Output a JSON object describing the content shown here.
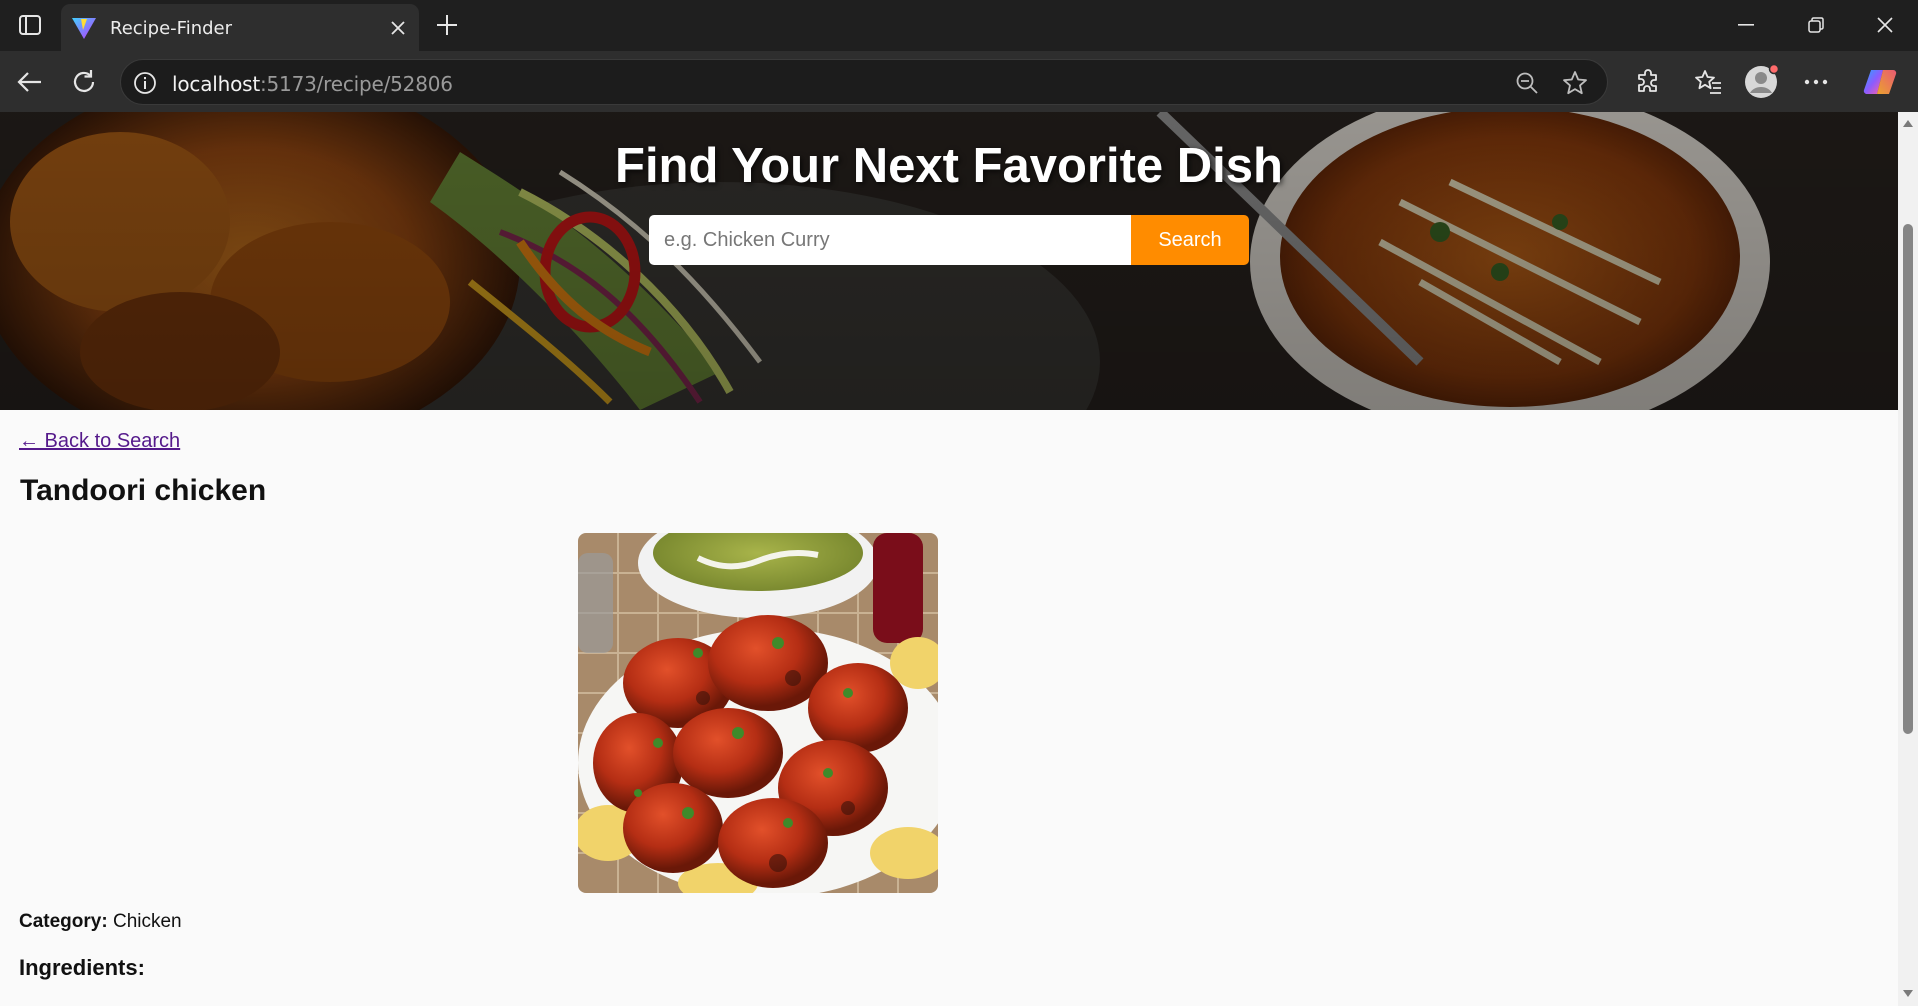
{
  "browser": {
    "tab_title": "Recipe-Finder",
    "url_host": "localhost",
    "url_path": ":5173/recipe/52806"
  },
  "hero": {
    "title": "Find Your Next Favorite Dish",
    "search_placeholder": "e.g. Chicken Curry",
    "search_button": "Search"
  },
  "recipe": {
    "back_link": "← Back to Search",
    "title": "Tandoori chicken",
    "category_label": "Category:",
    "category_value": "Chicken",
    "ingredients_heading": "Ingredients:"
  },
  "colors": {
    "accent": "#ff8c00",
    "chrome_dark": "#1f1f1f",
    "chrome_toolbar": "#2e2e2e",
    "link_visited": "#551a8b"
  },
  "icons": [
    "sidebar-toggle-icon",
    "vite-favicon-icon",
    "close-icon",
    "plus-icon",
    "minimize-icon",
    "restore-icon",
    "window-close-icon",
    "back-arrow-icon",
    "refresh-icon",
    "info-icon",
    "zoom-out-icon",
    "star-icon",
    "extensions-icon",
    "favorites-icon",
    "profile-avatar-icon",
    "more-icon",
    "copilot-icon"
  ]
}
